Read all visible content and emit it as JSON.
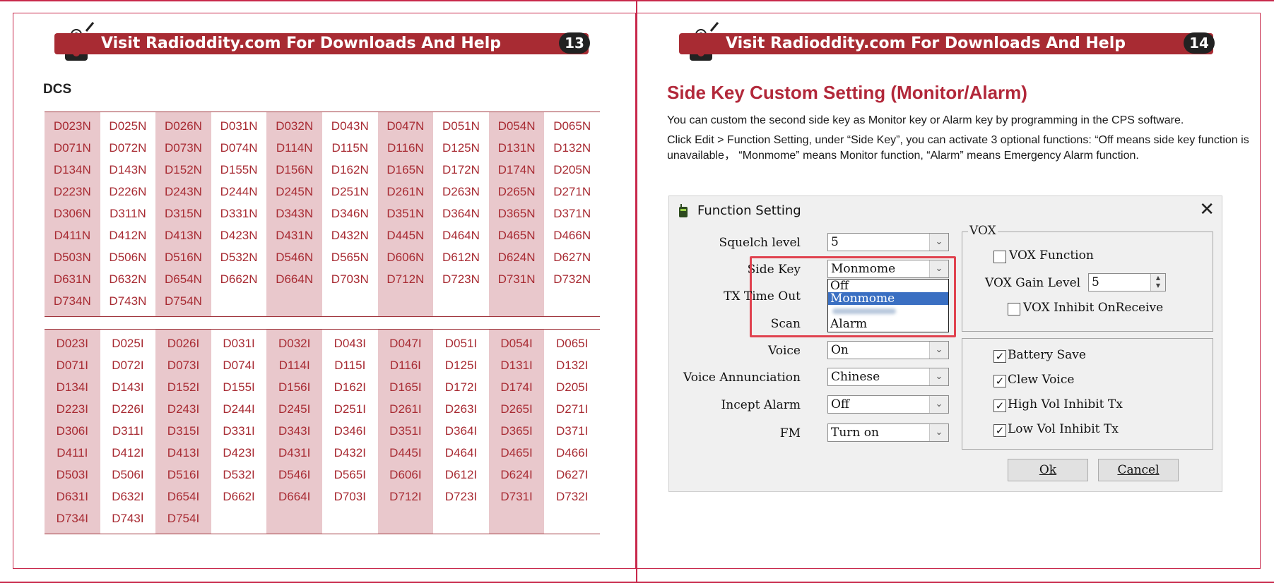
{
  "left_page": {
    "banner_text": "Visit Radioddity.com For Downloads And Help",
    "page_number": "13",
    "heading": "DCS",
    "table_n": [
      [
        "D023N",
        "D025N",
        "D026N",
        "D031N",
        "D032N",
        "D043N",
        "D047N",
        "D051N",
        "D054N",
        "D065N"
      ],
      [
        "D071N",
        "D072N",
        "D073N",
        "D074N",
        "D114N",
        "D115N",
        "D116N",
        "D125N",
        "D131N",
        "D132N"
      ],
      [
        "D134N",
        "D143N",
        "D152N",
        "D155N",
        "D156N",
        "D162N",
        "D165N",
        "D172N",
        "D174N",
        "D205N"
      ],
      [
        "D223N",
        "D226N",
        "D243N",
        "D244N",
        "D245N",
        "D251N",
        "D261N",
        "D263N",
        "D265N",
        "D271N"
      ],
      [
        "D306N",
        "D311N",
        "D315N",
        "D331N",
        "D343N",
        "D346N",
        "D351N",
        "D364N",
        "D365N",
        "D371N"
      ],
      [
        "D411N",
        "D412N",
        "D413N",
        "D423N",
        "D431N",
        "D432N",
        "D445N",
        "D464N",
        "D465N",
        "D466N"
      ],
      [
        "D503N",
        "D506N",
        "D516N",
        "D532N",
        "D546N",
        "D565N",
        "D606N",
        "D612N",
        "D624N",
        "D627N"
      ],
      [
        "D631N",
        "D632N",
        "D654N",
        "D662N",
        "D664N",
        "D703N",
        "D712N",
        "D723N",
        "D731N",
        "D732N"
      ],
      [
        "D734N",
        "D743N",
        "D754N",
        "",
        "",
        "",
        "",
        "",
        "",
        ""
      ]
    ],
    "table_i": [
      [
        "D023I",
        "D025I",
        "D026I",
        "D031I",
        "D032I",
        "D043I",
        "D047I",
        "D051I",
        "D054I",
        "D065I"
      ],
      [
        "D071I",
        "D072I",
        "D073I",
        "D074I",
        "D114I",
        "D115I",
        "D116I",
        "D125I",
        "D131I",
        "D132I"
      ],
      [
        "D134I",
        "D143I",
        "D152I",
        "D155I",
        "D156I",
        "D162I",
        "D165I",
        "D172I",
        "D174I",
        "D205I"
      ],
      [
        "D223I",
        "D226I",
        "D243I",
        "D244I",
        "D245I",
        "D251I",
        "D261I",
        "D263I",
        "D265I",
        "D271I"
      ],
      [
        "D306I",
        "D311I",
        "D315I",
        "D331I",
        "D343I",
        "D346I",
        "D351I",
        "D364I",
        "D365I",
        "D371I"
      ],
      [
        "D411I",
        "D412I",
        "D413I",
        "D423I",
        "D431I",
        "D432I",
        "D445I",
        "D464I",
        "D465I",
        "D466I"
      ],
      [
        "D503I",
        "D506I",
        "D516I",
        "D532I",
        "D546I",
        "D565I",
        "D606I",
        "D612I",
        "D624I",
        "D627I"
      ],
      [
        "D631I",
        "D632I",
        "D654I",
        "D662I",
        "D664I",
        "D703I",
        "D712I",
        "D723I",
        "D731I",
        "D732I"
      ],
      [
        "D734I",
        "D743I",
        "D754I",
        "",
        "",
        "",
        "",
        "",
        "",
        ""
      ]
    ]
  },
  "right_page": {
    "banner_text": "Visit Radioddity.com For Downloads And Help",
    "page_number": "14",
    "title": "Side Key Custom Setting (Monitor/Alarm)",
    "para1": "You can custom the second side key as Monitor key or Alarm key by programming in the CPS software.",
    "para2": "Click Edit > Function Setting, under “Side Key”, you can activate 3 optional functions: “Off means side key function is unavailable， “Monmome” means Monitor function, “Alarm” means Emergency Alarm function."
  },
  "dialog": {
    "title": "Function Setting",
    "close_glyph": "✕",
    "squelch_label": "Squelch level",
    "squelch_value": "5",
    "sidekey_label": "Side Key",
    "sidekey_value": "Monmome",
    "txtimeout_label": "TX Time Out",
    "scan_label": "Scan",
    "voice_label": "Voice",
    "voice_value": "On",
    "annunciation_label": "Voice Annunciation",
    "annunciation_value": "Chinese",
    "incept_label": "Incept Alarm",
    "incept_value": "Off",
    "fm_label": "FM",
    "fm_value": "Turn on",
    "dropdown_options": [
      "Off",
      "Monmome",
      "",
      "Alarm"
    ],
    "vox_group_title": "VOX",
    "vox_function_label": "VOX Function",
    "vox_gain_label": "VOX Gain Level",
    "vox_gain_value": "5",
    "vox_inhibit_label": "VOX Inhibit OnReceive",
    "battery_save_label": "Battery Save",
    "clew_voice_label": "Clew Voice",
    "high_vol_label": "High Vol Inhibit Tx",
    "low_vol_label": "Low Vol Inhibit Tx",
    "ok_label": "Ok",
    "cancel_label": "Cancel",
    "arrow_glyph": "⌄",
    "check_glyph": "✓",
    "spin_up": "▲",
    "spin_down": "▼"
  },
  "colors": {
    "brand_red": "#a82b33",
    "frame": "#c8284b",
    "shade": "#e9c8cc",
    "title_red": "#b2283a",
    "highlight": "#e0424f",
    "select_blue": "#3a6fc2"
  }
}
